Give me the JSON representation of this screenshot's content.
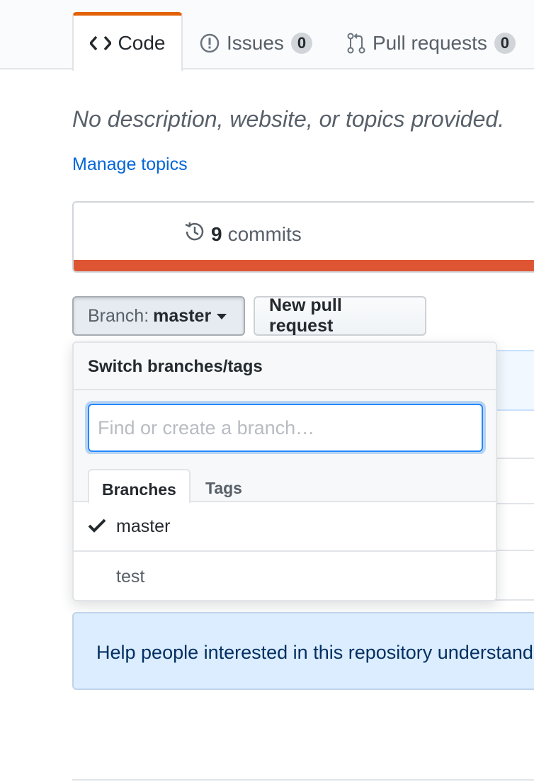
{
  "tabs": [
    {
      "label": "Code",
      "icon": "code-icon"
    },
    {
      "label": "Issues",
      "icon": "issue-opened-icon",
      "count": "0"
    },
    {
      "label": "Pull requests",
      "icon": "git-pull-request-icon",
      "count": "0"
    }
  ],
  "repo": {
    "description": "No description, website, or topics provided.",
    "manage_topics": "Manage topics",
    "commits_count": "9",
    "commits_label": "commits",
    "language_bar_color": "#dd5533"
  },
  "branch_button": {
    "label": "Branch:",
    "value": "master"
  },
  "new_pr_button": {
    "label": "New pull request"
  },
  "branch_dropdown": {
    "title": "Switch branches/tags",
    "filter_placeholder": "Find or create a branch…",
    "tabs": [
      "Branches",
      "Tags"
    ],
    "items": [
      {
        "name": "master",
        "selected": true
      },
      {
        "name": "test",
        "selected": false
      }
    ]
  },
  "help_banner": {
    "text": "Help people interested in this repository understand your project by adding a README."
  },
  "colors": {
    "accent_tab": "#e36209",
    "link": "#0366d6",
    "focus_border": "#2188ff"
  }
}
